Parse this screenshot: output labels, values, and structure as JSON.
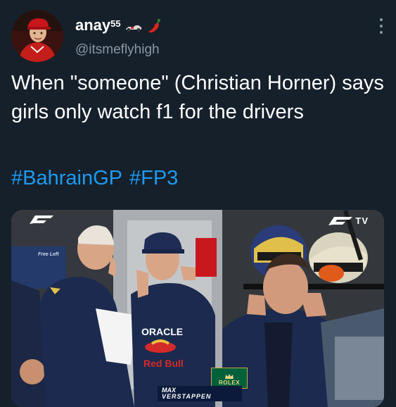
{
  "user": {
    "display_name": "anay",
    "display_name_superscript": "55",
    "handle": "@itsmeflyhigh",
    "name_emojis": [
      "race-car-icon",
      "chili-pepper-icon"
    ]
  },
  "tweet": {
    "text": "When \"someone\" (Christian Horner) says girls only watch f1 for the drivers",
    "hashtags": [
      "#BahrainGP",
      "#FP3"
    ]
  },
  "media": {
    "broadcaster_logo": "TV",
    "sponsor_badge": "ROLEX",
    "caption_first_name": "MAX",
    "caption_last_name": "VERSTAPPEN",
    "team_shirt_text": "ORACLE",
    "team_shirt_brand": "Red Bull",
    "back_wall_text": "Free Left"
  },
  "colors": {
    "background": "#15202b",
    "text": "#ffffff",
    "secondary": "#8b98a5",
    "link": "#1d9bf0"
  }
}
